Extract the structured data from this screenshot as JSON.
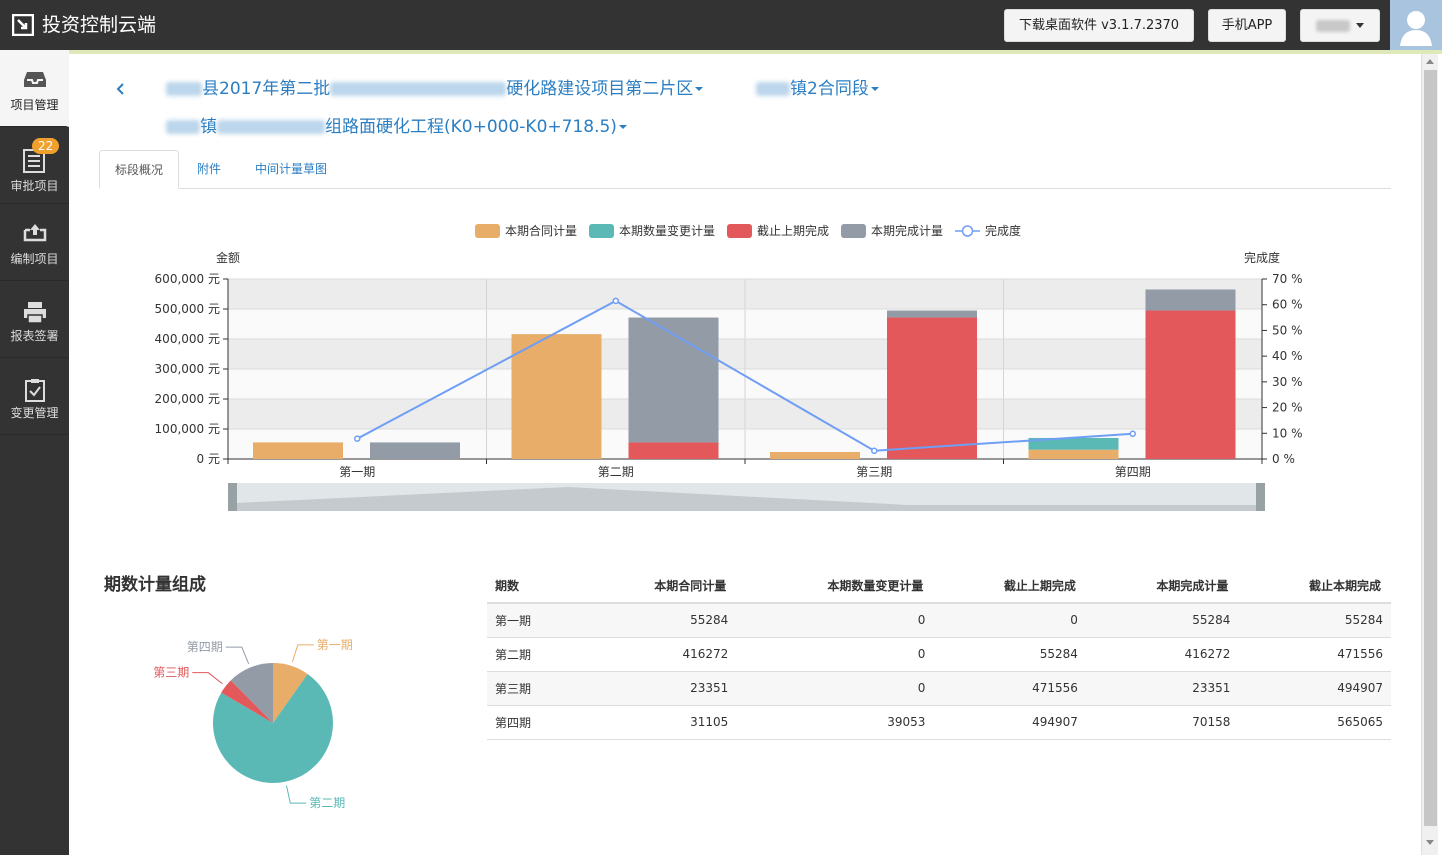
{
  "app": {
    "title": "投资控制云端",
    "download_label": "下载桌面软件 v3.1.7.2370",
    "mobile_label": "手机APP"
  },
  "sidebar": {
    "items": [
      {
        "label": "项目管理",
        "icon": "project-icon",
        "active": true
      },
      {
        "label": "审批项目",
        "icon": "checklist-icon",
        "badge": "22"
      },
      {
        "label": "编制项目",
        "icon": "upload-tray-icon"
      },
      {
        "label": "报表签署",
        "icon": "printer-icon"
      },
      {
        "label": "变更管理",
        "icon": "clipboard-icon"
      }
    ]
  },
  "breadcrumb": {
    "level1": "县2017年第二批",
    "level1_suffix": "硬化路建设项目第二片区",
    "level2": "镇2合同段",
    "level3_prefix": "镇",
    "level3": "组路面硬化工程(K0+000-K0+718.5)"
  },
  "tabs": [
    {
      "label": "标段概况",
      "active": true
    },
    {
      "label": "附件"
    },
    {
      "label": "中间计量草图"
    }
  ],
  "chart_data": {
    "type": "bar",
    "categories": [
      "第一期",
      "第二期",
      "第三期",
      "第四期"
    ],
    "series": [
      {
        "name": "本期合同计量",
        "stack": "a",
        "values": [
          55284,
          416272,
          23351,
          31105
        ],
        "color": "#e8ad68"
      },
      {
        "name": "本期数量变更计量",
        "stack": "a",
        "values": [
          0,
          0,
          0,
          39053
        ],
        "color": "#5ab9b5"
      },
      {
        "name": "截止上期完成",
        "stack": "b",
        "values": [
          0,
          55284,
          471556,
          494907
        ],
        "color": "#e2585b"
      },
      {
        "name": "本期完成计量",
        "stack": "b",
        "values": [
          55284,
          416272,
          23351,
          70158
        ],
        "color": "#939ba7"
      },
      {
        "name": "完成度",
        "type": "line",
        "axis": "right",
        "values": [
          7.9,
          61.5,
          3.2,
          9.8
        ],
        "color": "#6f9ef5"
      }
    ],
    "ylabel": "金额",
    "ylabel_right": "完成度",
    "ylim": [
      0,
      600000
    ],
    "ylim_right": [
      0,
      70
    ],
    "yticks": [
      "0 元",
      "100,000 元",
      "200,000 元",
      "300,000 元",
      "400,000 元",
      "500,000 元",
      "600,000 元"
    ],
    "yticks_right": [
      "0 %",
      "10 %",
      "20 %",
      "30 %",
      "40 %",
      "50 %",
      "60 %",
      "70 %"
    ],
    "legend_position": "top-center"
  },
  "pie": {
    "title": "期数计量组成",
    "slices": [
      {
        "name": "第一期",
        "value": 55284,
        "color": "#e8ad68"
      },
      {
        "name": "第二期",
        "value": 416272,
        "color": "#5ab9b5"
      },
      {
        "name": "第三期",
        "value": 23351,
        "color": "#e2585b"
      },
      {
        "name": "第四期",
        "value": 70158,
        "color": "#939ba7"
      }
    ]
  },
  "table": {
    "headers": [
      "期数",
      "本期合同计量",
      "本期数量变更计量",
      "截止上期完成",
      "本期完成计量",
      "截止本期完成"
    ],
    "rows": [
      [
        "第一期",
        "55284",
        "0",
        "0",
        "55284",
        "55284"
      ],
      [
        "第二期",
        "416272",
        "0",
        "55284",
        "416272",
        "471556"
      ],
      [
        "第三期",
        "23351",
        "0",
        "471556",
        "23351",
        "494907"
      ],
      [
        "第四期",
        "31105",
        "39053",
        "494907",
        "70158",
        "565065"
      ]
    ]
  }
}
